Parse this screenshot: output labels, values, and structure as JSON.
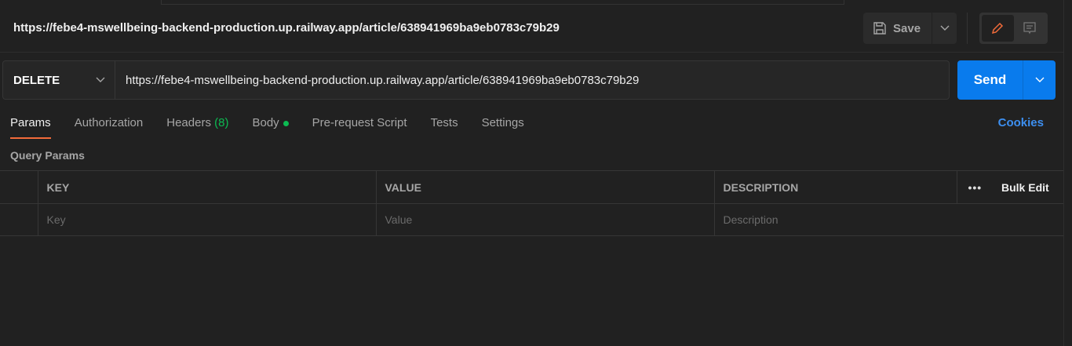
{
  "request": {
    "title": "https://febe4-mswellbeing-backend-production.up.railway.app/article/638941969ba9eb0783c79b29",
    "method": "DELETE",
    "url": "https://febe4-mswellbeing-backend-production.up.railway.app/article/638941969ba9eb0783c79b29"
  },
  "toolbar": {
    "save_label": "Save",
    "send_label": "Send"
  },
  "tabs": [
    {
      "label": "Params"
    },
    {
      "label": "Authorization"
    },
    {
      "label": "Headers",
      "count": "(8)"
    },
    {
      "label": "Body"
    },
    {
      "label": "Pre-request Script"
    },
    {
      "label": "Tests"
    },
    {
      "label": "Settings"
    }
  ],
  "cookies_label": "Cookies",
  "query_params": {
    "title": "Query Params",
    "columns": [
      "KEY",
      "VALUE",
      "DESCRIPTION"
    ],
    "bulk_edit": "Bulk Edit",
    "placeholders": {
      "key": "Key",
      "value": "Value",
      "description": "Description"
    }
  },
  "colors": {
    "accent": "#097bed",
    "active_tab": "#f26b3a",
    "green": "#0cbb52"
  }
}
